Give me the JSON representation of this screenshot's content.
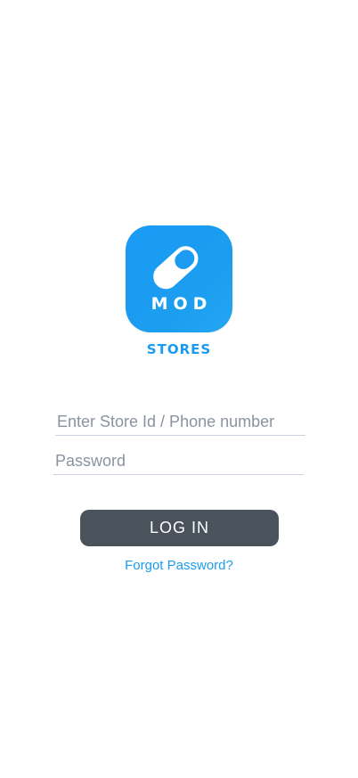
{
  "logo": {
    "icon": "pill-icon",
    "text": "MOD",
    "subtitle": "STORES",
    "color": "#1a9bf5"
  },
  "form": {
    "store_id_placeholder": "Enter Store Id / Phone number",
    "store_id_value": "",
    "password_placeholder": "Password",
    "password_value": ""
  },
  "login_button": {
    "label": "LOG IN",
    "color": "#4a525b"
  },
  "forgot_password": {
    "label": "Forgot Password?"
  },
  "colors": {
    "accent": "#1a9bf0",
    "background": "#ffffff"
  }
}
